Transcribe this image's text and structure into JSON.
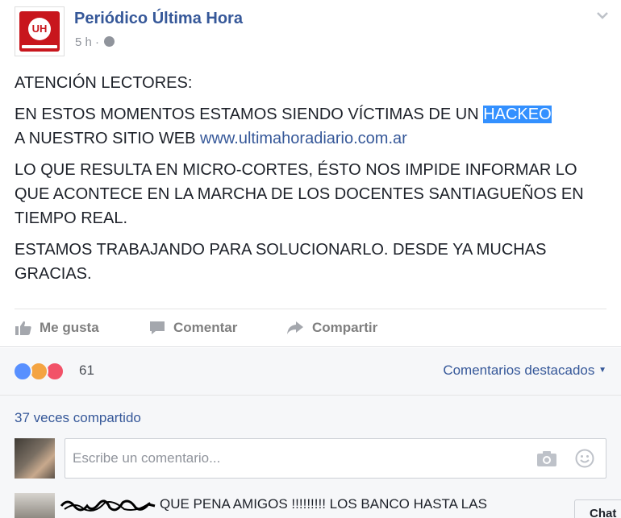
{
  "post": {
    "page_name": "Periódico Última Hora",
    "time": "5 h ·",
    "logo_text": "UH",
    "line1": "ATENCIÓN LECTORES:",
    "line2_a": "EN ESTOS MOMENTOS ESTAMOS SIENDO VÍCTIMAS DE UN ",
    "line2_highlight": "HACKEO",
    "line3_a": "A NUESTRO SITIO WEB ",
    "line3_link": "www.ultimahoradiario.com.ar",
    "para2": "LO QUE RESULTA EN MICRO-CORTES, ÉSTO NOS IMPIDE INFORMAR LO QUE ACONTECE EN LA MARCHA DE LOS DOCENTES SANTIAGUEÑOS EN TIEMPO REAL.",
    "para3": "ESTAMOS TRABAJANDO PARA SOLUCIONARLO. DESDE YA MUCHAS GRACIAS."
  },
  "actions": {
    "like": "Me gusta",
    "comment": "Comentar",
    "share": "Compartir"
  },
  "reactions": {
    "count": "61",
    "featured_comments": "Comentarios destacados"
  },
  "shares": {
    "text": "37 veces compartido"
  },
  "comment_input": {
    "placeholder": "Escribe un comentario..."
  },
  "comment": {
    "text": "QUE PENA AMIGOS !!!!!!!!! LOS BANCO HASTA LAS"
  },
  "chat": {
    "label": "Chat"
  },
  "colors": {
    "link": "#365899",
    "highlight": "#3390ff",
    "like_reaction": "#5890ff",
    "angry_reaction": "#f4a442",
    "love_reaction": "#f25268"
  }
}
